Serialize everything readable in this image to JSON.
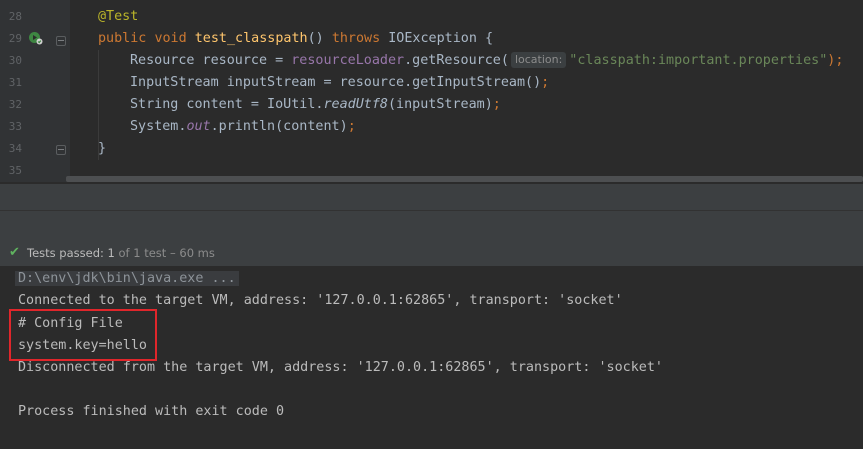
{
  "editor": {
    "lines": [
      {
        "num": "28",
        "tokens": [
          {
            "t": "@Test",
            "c": "a"
          }
        ]
      },
      {
        "num": "29",
        "tokens": [
          {
            "t": "public",
            "c": "k"
          },
          {
            "t": " ",
            "c": ""
          },
          {
            "t": "void",
            "c": "k"
          },
          {
            "t": " ",
            "c": ""
          },
          {
            "t": "test_classpath",
            "c": "f"
          },
          {
            "t": "() ",
            "c": ""
          },
          {
            "t": "throws",
            "c": "k"
          },
          {
            "t": " IOException {",
            "c": ""
          }
        ]
      },
      {
        "num": "30",
        "tokens": [
          {
            "t": "Resource resource = ",
            "c": ""
          },
          {
            "t": "resourceLoader",
            "c": "pv"
          },
          {
            "t": ".getResource(",
            "c": ""
          },
          {
            "t": "location:",
            "c": "hint"
          },
          {
            "t": "\"classpath:important.properties\"",
            "c": "s"
          },
          {
            "t": ");",
            "c": "k"
          }
        ]
      },
      {
        "num": "31",
        "tokens": [
          {
            "t": "InputStream inputStream = resource.getInputStream()",
            "c": ""
          },
          {
            "t": ";",
            "c": "k"
          }
        ]
      },
      {
        "num": "32",
        "tokens": [
          {
            "t": "String content = IoUtil.",
            "c": ""
          },
          {
            "t": "readUtf8",
            "c": "m"
          },
          {
            "t": "(inputStream)",
            "c": ""
          },
          {
            "t": ";",
            "c": "k"
          }
        ]
      },
      {
        "num": "33",
        "tokens": [
          {
            "t": "System.",
            "c": ""
          },
          {
            "t": "out",
            "c": "fi"
          },
          {
            "t": ".println(content)",
            "c": ""
          },
          {
            "t": ";",
            "c": "k"
          }
        ]
      },
      {
        "num": "34",
        "tokens": [
          {
            "t": "}",
            "c": ""
          }
        ]
      },
      {
        "num": "35",
        "tokens": []
      }
    ]
  },
  "status": {
    "label": "Tests passed: ",
    "passed": "1",
    "rest": " of 1 test – 60 ms"
  },
  "console": {
    "command": "D:\\env\\jdk\\bin\\java.exe ...",
    "connected": "Connected to the target VM, address: '127.0.0.1:62865', transport: 'socket'",
    "config_header": "# Config File",
    "config_value": "system.key=hello",
    "disconnected": "Disconnected from the target VM, address: '127.0.0.1:62865', transport: 'socket'",
    "exit": "Process finished with exit code 0"
  },
  "colors": {
    "keyword": "#cc7832",
    "annotation": "#bbb529",
    "method_decl": "#ffc66d",
    "string": "#6a8759",
    "field": "#9876aa",
    "pass_green": "#5fb35f",
    "highlight_box": "#e0262b"
  },
  "icons": {
    "run": "run-test-icon",
    "status": "check-icon"
  }
}
